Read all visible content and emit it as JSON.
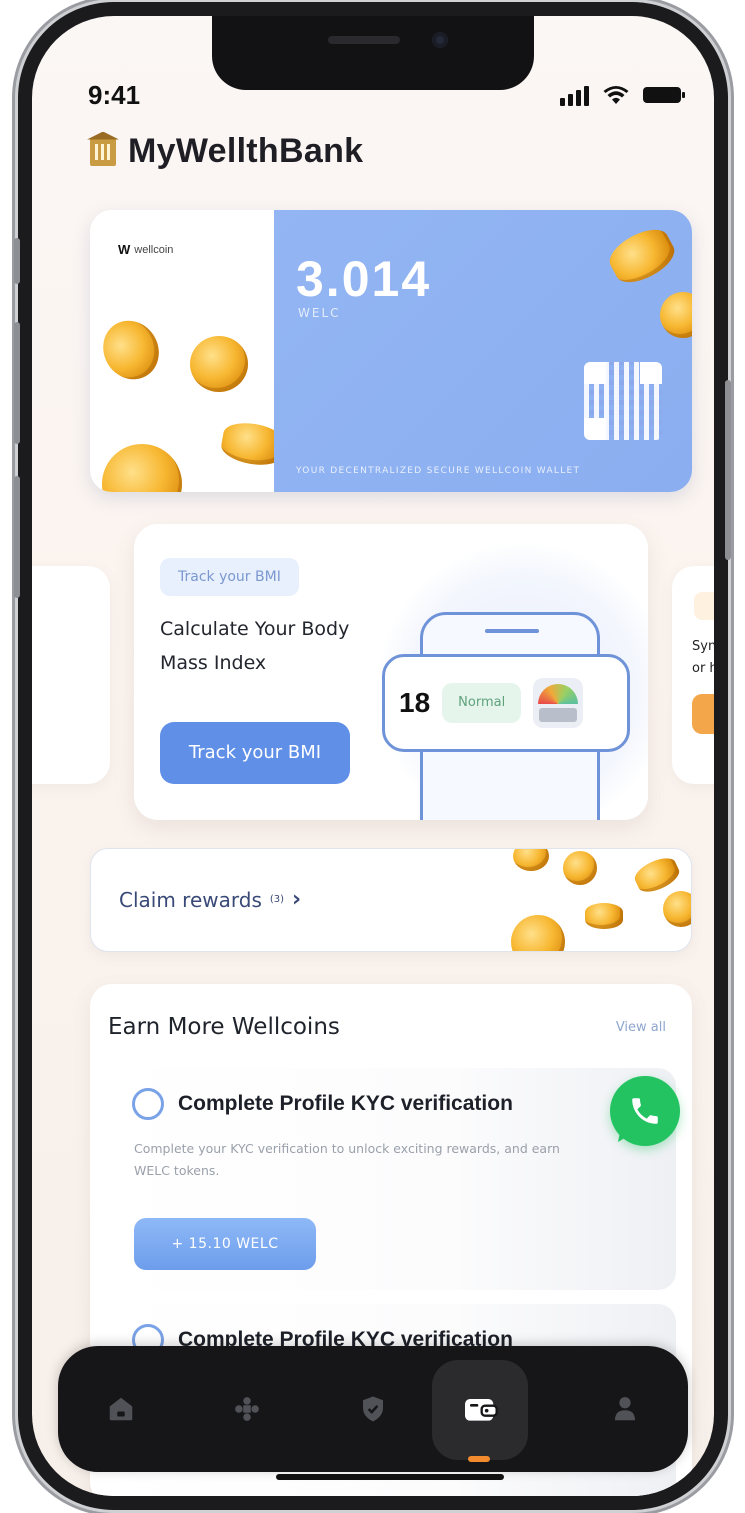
{
  "status_bar": {
    "time": "9:41"
  },
  "header": {
    "app_name": "MyWellthBank"
  },
  "wallet_card": {
    "brand_mark": "W",
    "brand_name": "wellcoin",
    "balance": "3.014",
    "unit": "WELC",
    "tagline": "YOUR DECENTRALIZED SECURE WELLCOIN WALLET"
  },
  "bmi_card": {
    "chip": "Track your BMI",
    "title": "Calculate Your Body Mass Index",
    "button_label": "Track your BMI",
    "bmi_value": "18",
    "bmi_status": "Normal"
  },
  "next_card": {
    "text_line1": "Sync",
    "text_line2": "or h"
  },
  "rewards": {
    "label": "Claim rewards",
    "count": "(3)",
    "chevron": "›"
  },
  "earn": {
    "title": "Earn More Wellcoins",
    "view_all": "View all",
    "tasks": [
      {
        "title": "Complete Profile KYC verification",
        "description": "Complete your KYC verification to unlock exciting rewards, and earn WELC tokens.",
        "reward": "+ 15.10 WELC"
      },
      {
        "title": "Complete Profile KYC verification",
        "description": "",
        "reward": ""
      }
    ]
  },
  "tab_bar": {
    "tabs": [
      {
        "icon": "home-icon",
        "active": false
      },
      {
        "icon": "gamepad-icon",
        "active": false
      },
      {
        "icon": "shield-icon",
        "active": false
      },
      {
        "icon": "wallet-icon",
        "active": true
      },
      {
        "icon": "profile-icon",
        "active": false
      }
    ],
    "accent": "#f28b2d"
  },
  "colors": {
    "wallet_blue": "#8aaef0",
    "primary_button": "#5f8fe6",
    "whatsapp_green": "#23c362"
  }
}
